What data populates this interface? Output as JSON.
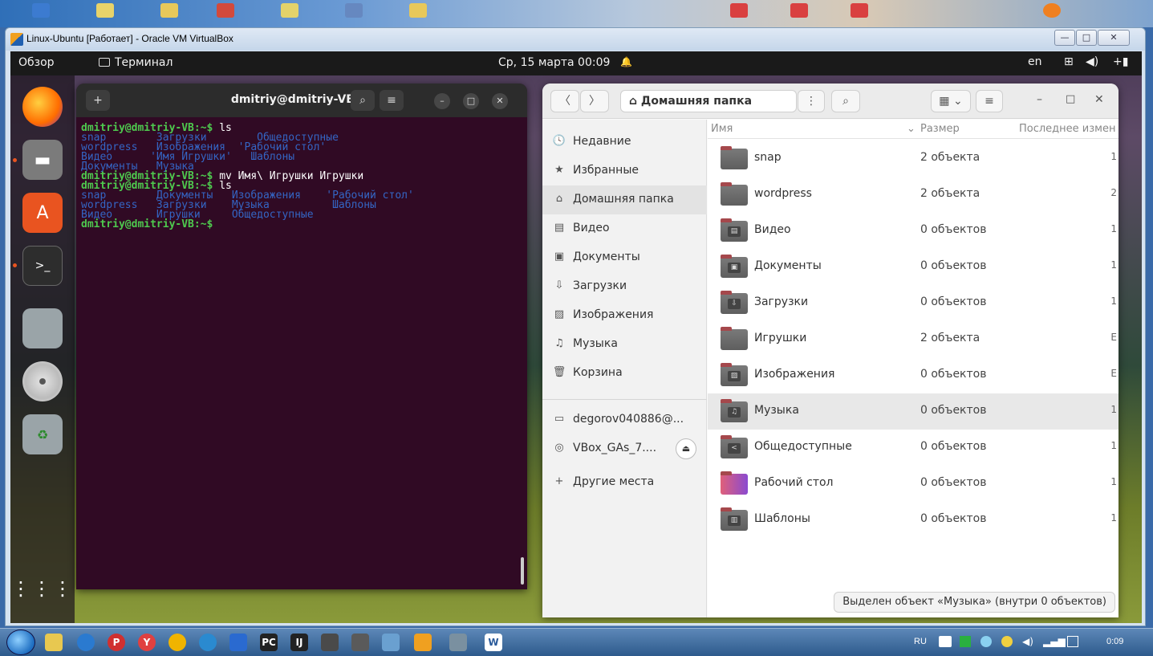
{
  "vbox": {
    "title": "Linux-Ubuntu [Работает] - Oracle VM VirtualBox",
    "minimize": "—",
    "maximize": "□",
    "close": "✕"
  },
  "topbar": {
    "overview": "Обзор",
    "app_name": "Терминал",
    "datetime": "Ср, 15 марта 00:09",
    "bell": "🔔",
    "lang": "en",
    "network_icon": "⊞",
    "volume_icon": "◀)",
    "battery_icon": "+▮"
  },
  "terminal": {
    "title": "dmitriy@dmitriy-VB: ~",
    "lines": [
      {
        "prompt": "dmitriy@dmitriy-VB:~$ ",
        "cmd": "ls"
      },
      {
        "dirs": "snap        Загрузки        Общедоступные"
      },
      {
        "dirs": "wordpress   Изображения  'Рабочий стол'"
      },
      {
        "dirs": "Видео      'Имя Игрушки'   Шаблоны"
      },
      {
        "dirs": "Документы   Музыка"
      },
      {
        "prompt": "dmitriy@dmitriy-VB:~$ ",
        "cmd": "mv Имя\\ Игрушки Игрушки"
      },
      {
        "prompt": "dmitriy@dmitriy-VB:~$ ",
        "cmd": "ls"
      },
      {
        "dirs": "snap        Документы   Изображения    'Рабочий стол'"
      },
      {
        "dirs": "wordpress   Загрузки    Музыка          Шаблоны"
      },
      {
        "dirs": "Видео       Игрушки     Общедоступные"
      },
      {
        "prompt": "dmitriy@dmitriy-VB:~$ ",
        "cmd": ""
      }
    ]
  },
  "files": {
    "path": "Домашняя папка",
    "columns": {
      "name": "Имя",
      "size": "Размер",
      "modified": "Последнее измен"
    },
    "sidebar": [
      {
        "icon": "🕓",
        "label": "Недавние"
      },
      {
        "icon": "★",
        "label": "Избранные"
      },
      {
        "icon": "⌂",
        "label": "Домашняя папка"
      },
      {
        "icon": "▤",
        "label": "Видео"
      },
      {
        "icon": "▣",
        "label": "Документы"
      },
      {
        "icon": "⇩",
        "label": "Загрузки"
      },
      {
        "icon": "▨",
        "label": "Изображения"
      },
      {
        "icon": "♫",
        "label": "Музыка"
      },
      {
        "icon": "🗑",
        "label": "Корзина"
      },
      {
        "icon": "▭",
        "label": "degorov040886@..."
      },
      {
        "icon": "◎",
        "label": "VBox_GAs_7...."
      },
      {
        "icon": "+",
        "label": "Другие места"
      }
    ],
    "rows": [
      {
        "name": "snap",
        "size": "2 объекта",
        "mod": "1",
        "glyph": ""
      },
      {
        "name": "wordpress",
        "size": "2 объекта",
        "mod": "2",
        "glyph": ""
      },
      {
        "name": "Видео",
        "size": "0 объектов",
        "mod": "1",
        "glyph": "▤"
      },
      {
        "name": "Документы",
        "size": "0 объектов",
        "mod": "1",
        "glyph": "▣"
      },
      {
        "name": "Загрузки",
        "size": "0 объектов",
        "mod": "1",
        "glyph": "⇩"
      },
      {
        "name": "Игрушки",
        "size": "2 объекта",
        "mod": "E",
        "glyph": ""
      },
      {
        "name": "Изображения",
        "size": "0 объектов",
        "mod": "E",
        "glyph": "▨"
      },
      {
        "name": "Музыка",
        "size": "0 объектов",
        "mod": "1",
        "glyph": "♫"
      },
      {
        "name": "Общедоступные",
        "size": "0 объектов",
        "mod": "1",
        "glyph": "<"
      },
      {
        "name": "Рабочий стол",
        "size": "0 объектов",
        "mod": "1",
        "glyph": ""
      },
      {
        "name": "Шаблоны",
        "size": "0 объектов",
        "mod": "1",
        "glyph": "▥"
      }
    ],
    "status": "Выделен объект «Музыка» (внутри 0 объектов)"
  },
  "taskbar": {
    "lang": "RU",
    "time": "0:09"
  }
}
